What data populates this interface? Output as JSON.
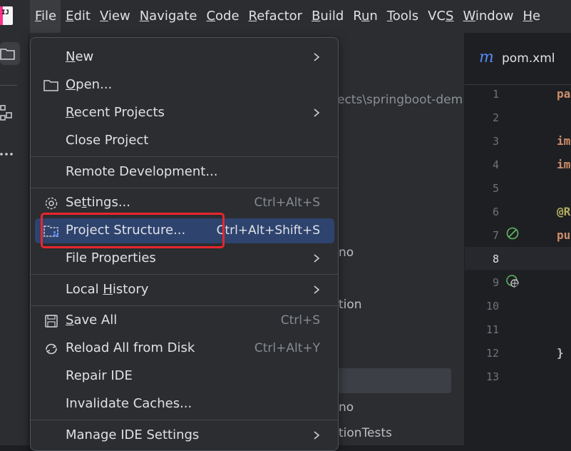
{
  "menubar": {
    "logo_text": "IJ",
    "items": [
      {
        "pre": "",
        "u": "F",
        "post": "ile"
      },
      {
        "pre": "",
        "u": "E",
        "post": "dit"
      },
      {
        "pre": "",
        "u": "V",
        "post": "iew"
      },
      {
        "pre": "",
        "u": "N",
        "post": "avigate"
      },
      {
        "pre": "",
        "u": "C",
        "post": "ode"
      },
      {
        "pre": "",
        "u": "R",
        "post": "efactor"
      },
      {
        "pre": "",
        "u": "B",
        "post": "uild"
      },
      {
        "pre": "R",
        "u": "u",
        "post": "n"
      },
      {
        "pre": "",
        "u": "T",
        "post": "ools"
      },
      {
        "pre": "VC",
        "u": "S",
        "post": ""
      },
      {
        "pre": "",
        "u": "W",
        "post": "indow"
      },
      {
        "pre": "",
        "u": "H",
        "post": "e"
      }
    ]
  },
  "tree": {
    "path_fragment": "ects\\springboot-dem",
    "row_mo_1": "no",
    "row_ation": "tion",
    "row_mo_2": "no",
    "row_tests": "tionTests"
  },
  "editor": {
    "tab_icon": "m",
    "tab_label": "pom.xml",
    "line_numbers": [
      "1",
      "2",
      "3",
      "4",
      "5",
      "6",
      "7",
      "8",
      "9",
      "10",
      "11",
      "12",
      "13"
    ],
    "current_line": "8",
    "code_line1": "pa",
    "code_line3": "im",
    "code_line4": "im",
    "code_line6": "@R",
    "code_line7": "pu",
    "code_line12": "}"
  },
  "file_menu": {
    "new": {
      "pre": "",
      "u": "N",
      "post": "ew"
    },
    "open": {
      "pre": "",
      "u": "O",
      "post": "pen..."
    },
    "recent": {
      "pre": "",
      "u": "R",
      "post": "ecent Projects"
    },
    "close": "Close Project",
    "remote": "Remote Development...",
    "settings": {
      "pre": "Se",
      "u": "t",
      "post": "tings...",
      "shortcut": "Ctrl+Alt+S"
    },
    "project_structure": {
      "label": "Project Structure...",
      "shortcut": "Ctrl+Alt+Shift+S"
    },
    "file_properties": "File Properties",
    "local_history": {
      "pre": "Local ",
      "u": "H",
      "post": "istory"
    },
    "save_all": {
      "pre": "",
      "u": "S",
      "post": "ave All",
      "shortcut": "Ctrl+S"
    },
    "reload": {
      "label": "Reload All from Disk",
      "shortcut": "Ctrl+Alt+Y"
    },
    "repair": "Repair IDE",
    "invalidate": "Invalidate Caches...",
    "manage": "Manage IDE Settings"
  },
  "colors": {
    "accent": "#2e436e",
    "highlight_box": "#e8262d",
    "keyword": "#cf8e6d",
    "annotation": "#b3ae60"
  }
}
